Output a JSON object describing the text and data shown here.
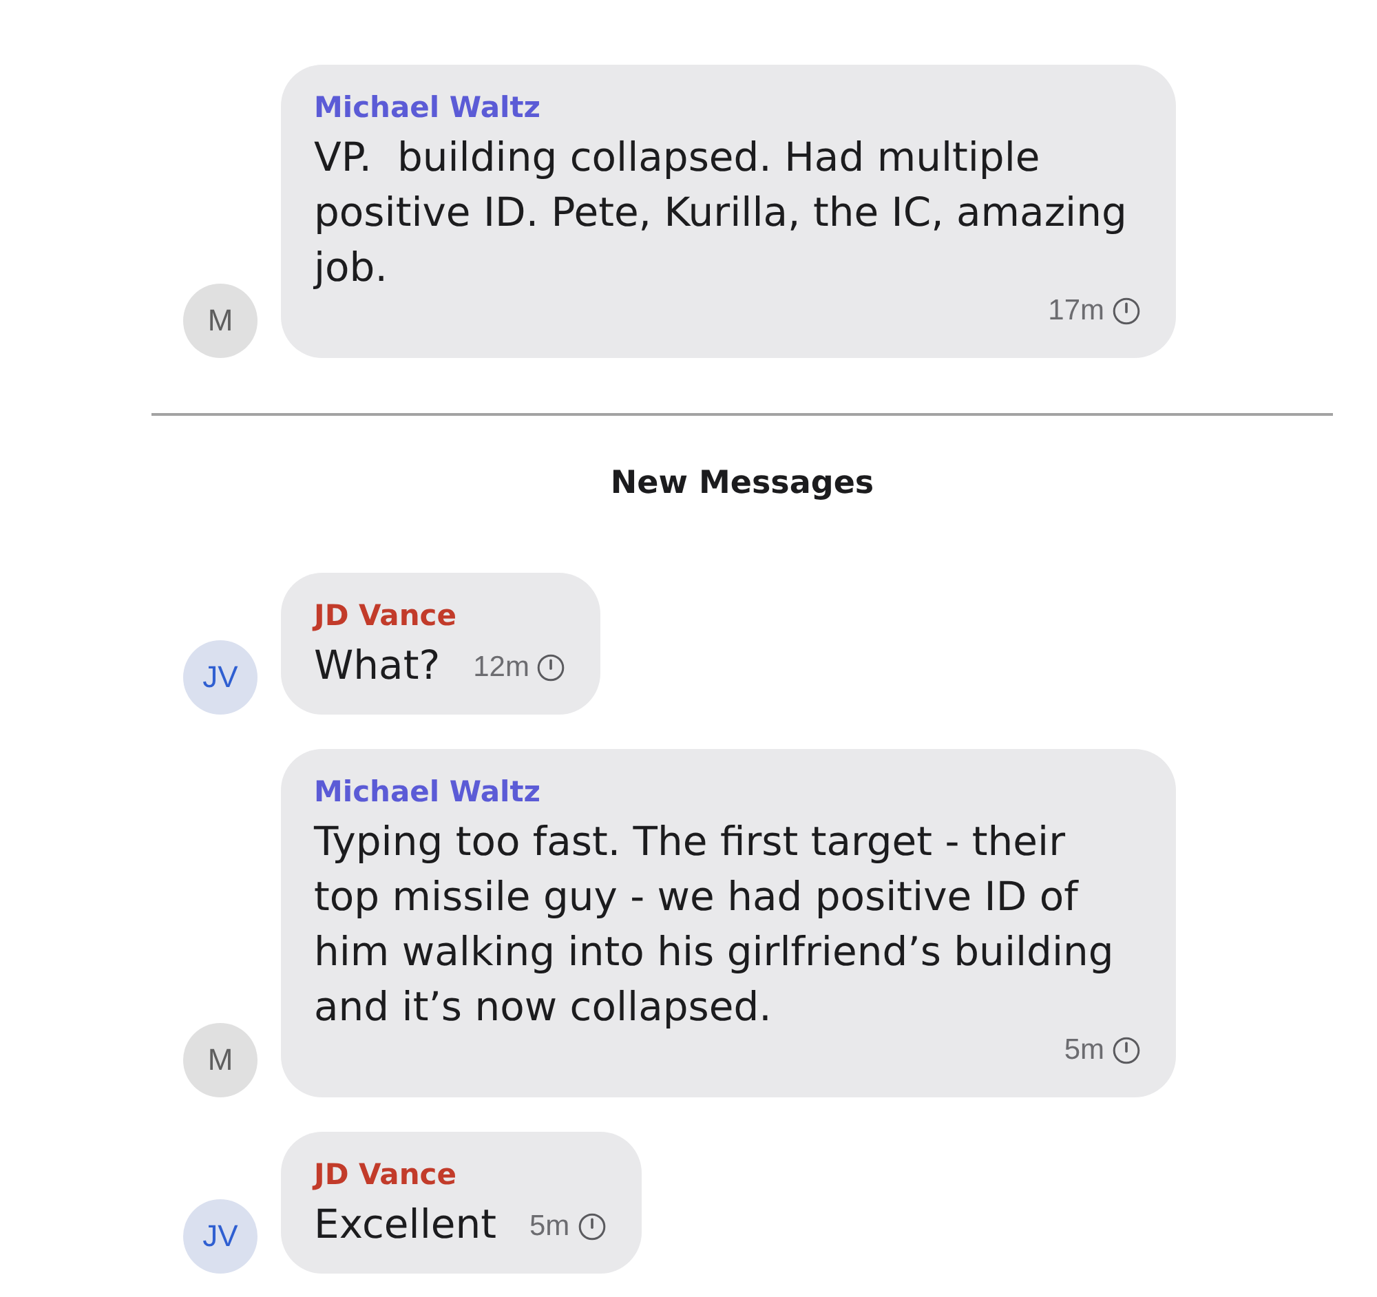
{
  "earlier_messages": [
    {
      "sender": {
        "name": "Michael Waltz",
        "color": "#5b5bd6"
      },
      "avatar": {
        "initials": "M",
        "color": "#5e5e5e"
      },
      "text": "VP.  building collapsed. Had multiple positive ID. Pete, Kurilla, the IC, amazing job.",
      "time": "17m"
    }
  ],
  "new_messages_divider": {
    "label": "New Messages"
  },
  "new_messages": [
    {
      "sender": {
        "name": "JD Vance",
        "color": "#c23b2a"
      },
      "avatar": {
        "initials": "JV",
        "color": "#2f5fd1"
      },
      "text": "What?",
      "time": "12m"
    },
    {
      "sender": {
        "name": "Michael Waltz",
        "color": "#5b5bd6"
      },
      "avatar": {
        "initials": "M",
        "color": "#5e5e5e"
      },
      "text": "Typing too fast. The first target - their top missile guy - we had positive ID of him walking into his girlfriend’s building and it’s now collapsed.",
      "time": "5m"
    },
    {
      "sender": {
        "name": "JD Vance",
        "color": "#c23b2a"
      },
      "avatar": {
        "initials": "JV",
        "color": "#2f5fd1"
      },
      "text": "Excellent",
      "time": "5m"
    }
  ]
}
